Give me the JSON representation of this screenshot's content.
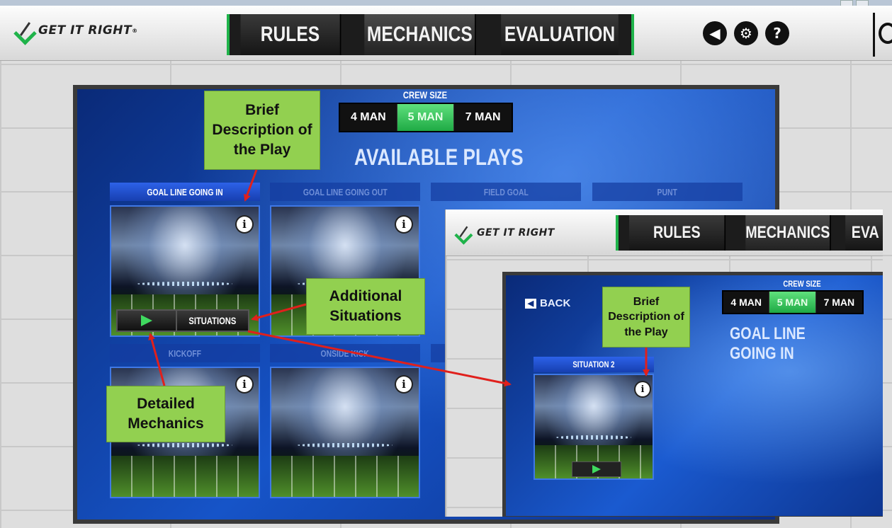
{
  "app": {
    "logo_text": "GET IT RIGHT",
    "logo_mark": "®",
    "nav": [
      "RULES",
      "MECHANICS",
      "EVALUATION"
    ],
    "header_icons": [
      "speaker-icon",
      "gear-icon",
      "help-icon"
    ],
    "accent_color": "#1fb34a",
    "panel_color": "#1654c8"
  },
  "main": {
    "crew_size_label": "CREW SIZE",
    "crew_options": [
      "4 MAN",
      "5 MAN",
      "7 MAN"
    ],
    "crew_selected": "5 MAN",
    "heading": "AVAILABLE PLAYS",
    "categories": [
      "GOAL LINE GOING IN",
      "GOAL LINE GOING OUT",
      "FIELD GOAL",
      "PUNT"
    ],
    "row2_categories": [
      "KICKOFF",
      "ONSIDE KICK"
    ],
    "situations_label": "SITUATIONS"
  },
  "inset": {
    "logo_text": "GET IT RIGHT",
    "nav": [
      "RULES",
      "MECHANICS",
      "EVA"
    ],
    "back_label": "BACK",
    "crew_size_label": "CREW SIZE",
    "crew_options": [
      "4 MAN",
      "5 MAN",
      "7 MAN"
    ],
    "crew_selected": "5 MAN",
    "heading": "GOAL LINE GOING IN",
    "situation_label": "SITUATION 2"
  },
  "annotations": {
    "brief_description": "Brief Description of the Play",
    "additional_situations": "Additional Situations",
    "detailed_mechanics": "Detailed Mechanics",
    "inset_brief_description": "Brief Description of the Play"
  }
}
